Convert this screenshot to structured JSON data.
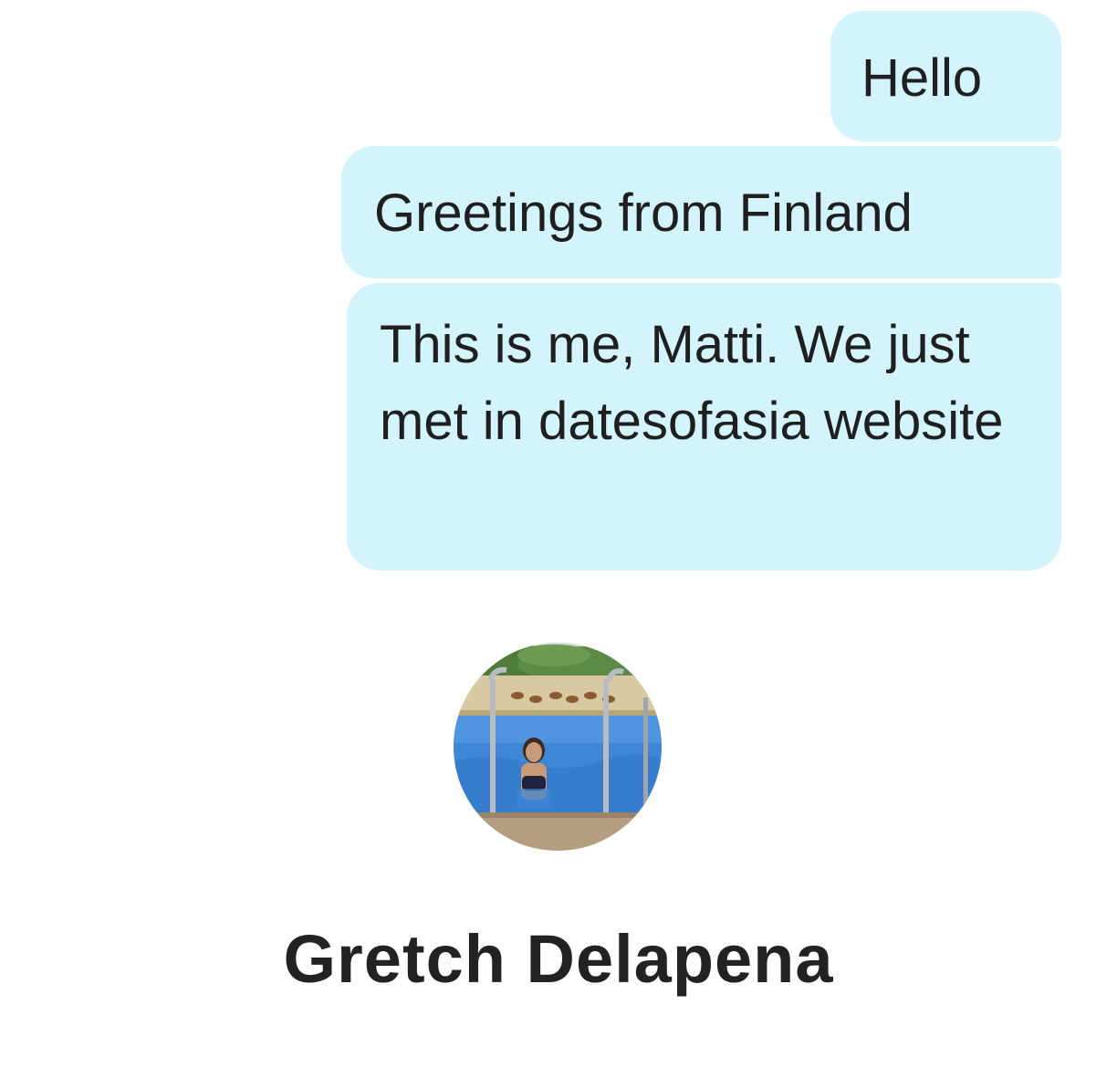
{
  "messages": [
    {
      "text": "Hello"
    },
    {
      "text": "Greetings from Finland"
    },
    {
      "text": "This is me, Matti. We just met in datesofasia website"
    }
  ],
  "profile": {
    "name": "Gretch Delapena",
    "avatar_icon": "profile-photo"
  },
  "colors": {
    "outgoing_bubble": "#d3f4fd",
    "text": "#1f1f1f"
  }
}
